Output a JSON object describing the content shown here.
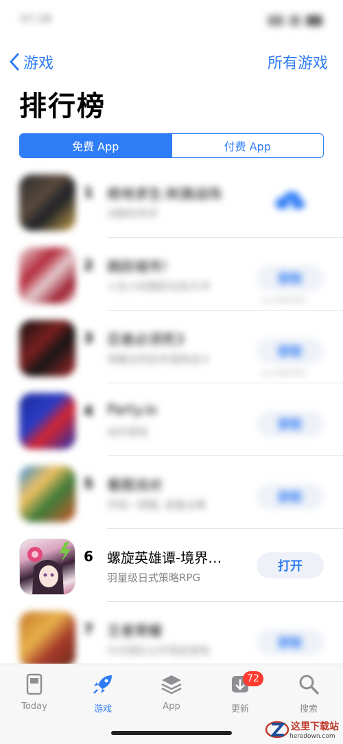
{
  "status_bar": {
    "time": "07:28"
  },
  "nav": {
    "back_label": "游戏",
    "right_label": "所有游戏"
  },
  "page": {
    "title": "排行榜"
  },
  "segments": [
    {
      "label": "免费 App",
      "active": true
    },
    {
      "label": "付费 App",
      "active": false
    }
  ],
  "apps": [
    {
      "rank": "1",
      "name": "绝地求生:刺激战场",
      "subtitle": "决胜吃鸡手",
      "action": "cloud-download",
      "iap": ""
    },
    {
      "rank": "2",
      "name": "跳跃城市!",
      "subtitle": "人生小的跳跃也有大冲",
      "action": "获取",
      "iap": "App 内购买项目"
    },
    {
      "rank": "3",
      "name": "忍者必须死3",
      "subtitle": "用最全的武术道具战斗",
      "action": "获取",
      "iap": "App 内购买项目"
    },
    {
      "rank": "4",
      "name": "Party.io",
      "subtitle": "动作游戏",
      "action": "获取",
      "iap": ""
    },
    {
      "rank": "5",
      "name": "看图派对",
      "subtitle": "开局一把图, 装备全靠",
      "action": "获取",
      "iap": ""
    },
    {
      "rank": "6",
      "name": "螺旋英雄谭-境界…",
      "subtitle": "羽量级日式策略RPG",
      "action": "打开",
      "iap": ""
    },
    {
      "rank": "7",
      "name": "王者荣耀",
      "subtitle": "5V5团队公平竞技游戏",
      "action": "获取",
      "iap": ""
    }
  ],
  "tabbar": [
    {
      "label": "Today",
      "icon": "today-icon"
    },
    {
      "label": "游戏",
      "icon": "rocket-icon",
      "active": true
    },
    {
      "label": "App",
      "icon": "layers-icon"
    },
    {
      "label": "更新",
      "icon": "download-icon",
      "badge": "72"
    },
    {
      "label": "搜索",
      "icon": "search-icon"
    }
  ],
  "watermark": {
    "title": "这里下载站",
    "url": "heredown.com"
  },
  "colors": {
    "accent": "#2e7cf6",
    "badge": "#ff3b30"
  }
}
